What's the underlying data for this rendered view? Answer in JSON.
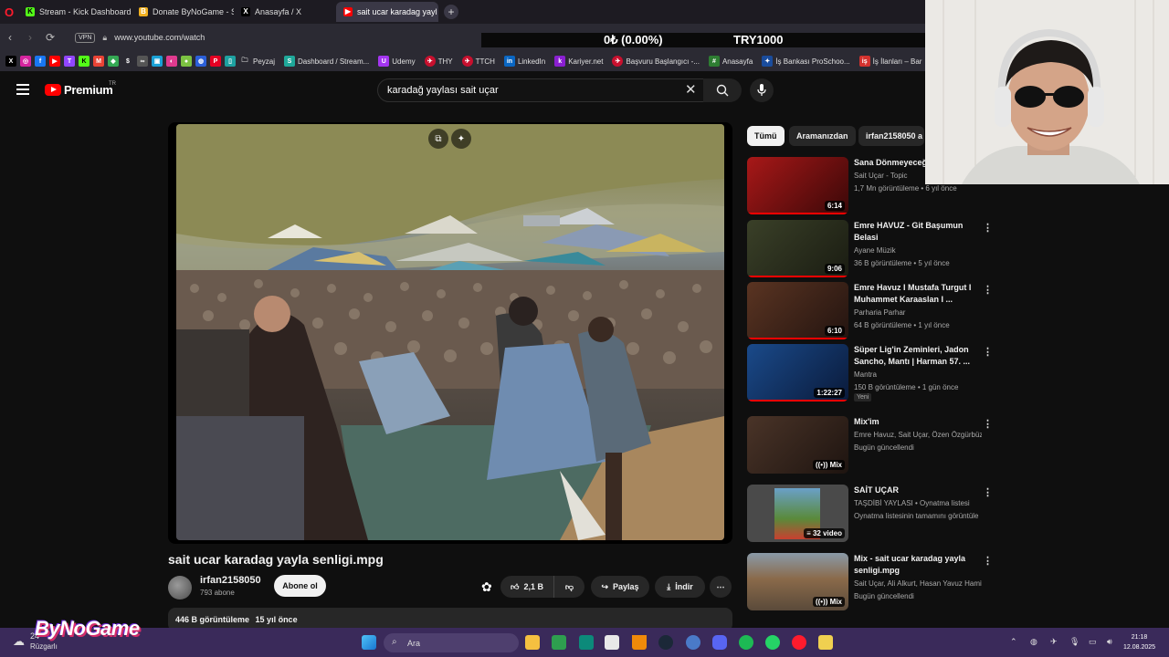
{
  "browser": {
    "tabs": [
      {
        "label": "Stream - Kick Dashboard",
        "color": "#53fc18"
      },
      {
        "label": "Donate ByNoGame - Stre",
        "color": "#f0b020"
      },
      {
        "label": "Anasayfa / X",
        "color": "#000000"
      },
      {
        "label": "sait ucar karadag yayl",
        "color": "#ff0000",
        "active": true
      }
    ],
    "vpn_label": "VPN",
    "url": "www.youtube.com/watch",
    "bookmarks": [
      {
        "label": "Peyzaj"
      },
      {
        "label": "Dashboard / Stream..."
      },
      {
        "label": "Udemy"
      },
      {
        "label": "THY"
      },
      {
        "label": "TTCH"
      },
      {
        "label": "LinkedIn"
      },
      {
        "label": "Kariyer.net"
      },
      {
        "label": "Başvuru Başlangıcı -..."
      },
      {
        "label": "Anasayfa"
      },
      {
        "label": "İş Bankası ProSchoo..."
      },
      {
        "label": "İş İlanları – Bar"
      }
    ]
  },
  "ticker": {
    "left": "0₺ (0.00%)",
    "right": "TRY1000"
  },
  "youtube": {
    "brand": "Premium",
    "region": "TR",
    "search_query": "karadağ yaylası sait uçar",
    "video": {
      "title": "sait ucar karadag yayla senligi.mpg",
      "channel": "irfan2158050",
      "subscribers": "793 abone",
      "subscribe_label": "Abone ol",
      "likes": "2,1 B",
      "share_label": "Paylaş",
      "download_label": "İndir",
      "views": "446 B görüntüleme",
      "age": "15 yıl önce"
    },
    "chips": [
      {
        "label": "Tümü",
        "active": true
      },
      {
        "label": "Aramanızdan",
        "active": false
      },
      {
        "label": "irfan2158050 a",
        "active": false
      }
    ],
    "recommendations": [
      {
        "title": "Sana Dönmeyeceğ",
        "channel": "Sait Uçar - Topic",
        "meta": "1,7 Mn görüntüleme • 6 yıl önce",
        "duration": "6:14",
        "thumb": "#7a1010"
      },
      {
        "title": "Emre HAVUZ - Git Başumun Belasi",
        "channel": "Ayane Müzik",
        "meta": "36 B görüntüleme • 5 yıl önce",
        "duration": "9:06",
        "thumb": "#2a3020"
      },
      {
        "title": "Emre Havuz I Mustafa Turgut I Muhammet Karaaslan I ...",
        "channel": "Parharia Parhar",
        "meta": "64 B görüntüleme • 1 yıl önce",
        "duration": "6:10",
        "thumb": "#3a2418"
      },
      {
        "title": "Süper Lig'in Zeminleri, Jadon Sancho, Mantı | Harman 57. ...",
        "channel": "Mantra",
        "meta": "150 B görüntüleme • 1 gün önce",
        "duration": "1:22:27",
        "thumb": "#123a70",
        "badge": "Yeni"
      },
      {
        "title": "Mix'im",
        "channel": "Emre Havuz, Sait Uçar, Özen Özgürbüz v...",
        "meta": "Bugün güncellendi",
        "duration": "Mix",
        "thumb": "#3b2a22"
      },
      {
        "title": "SAİT UÇAR",
        "channel": "TAŞDİBİ YAYLASI • Oynatma listesi",
        "meta": "Oynatma listesinin tamamını görüntüle",
        "duration": "32 video",
        "thumb": "#5a7a3a"
      },
      {
        "title": "Mix - sait ucar karadag yayla senligi.mpg",
        "channel": "Sait Uçar, Ali Alkurt, Hasan Yavuz Hamit ...",
        "meta": "Bugün güncellendi",
        "duration": "Mix",
        "thumb": "#6c6a50"
      }
    ]
  },
  "taskbar": {
    "weather_temp": "24",
    "weather_desc": "Rüzgarlı",
    "overlay_logo": "ByNoGame",
    "search_label": "Ara",
    "time": "21:18",
    "date": "12.08.2025"
  }
}
